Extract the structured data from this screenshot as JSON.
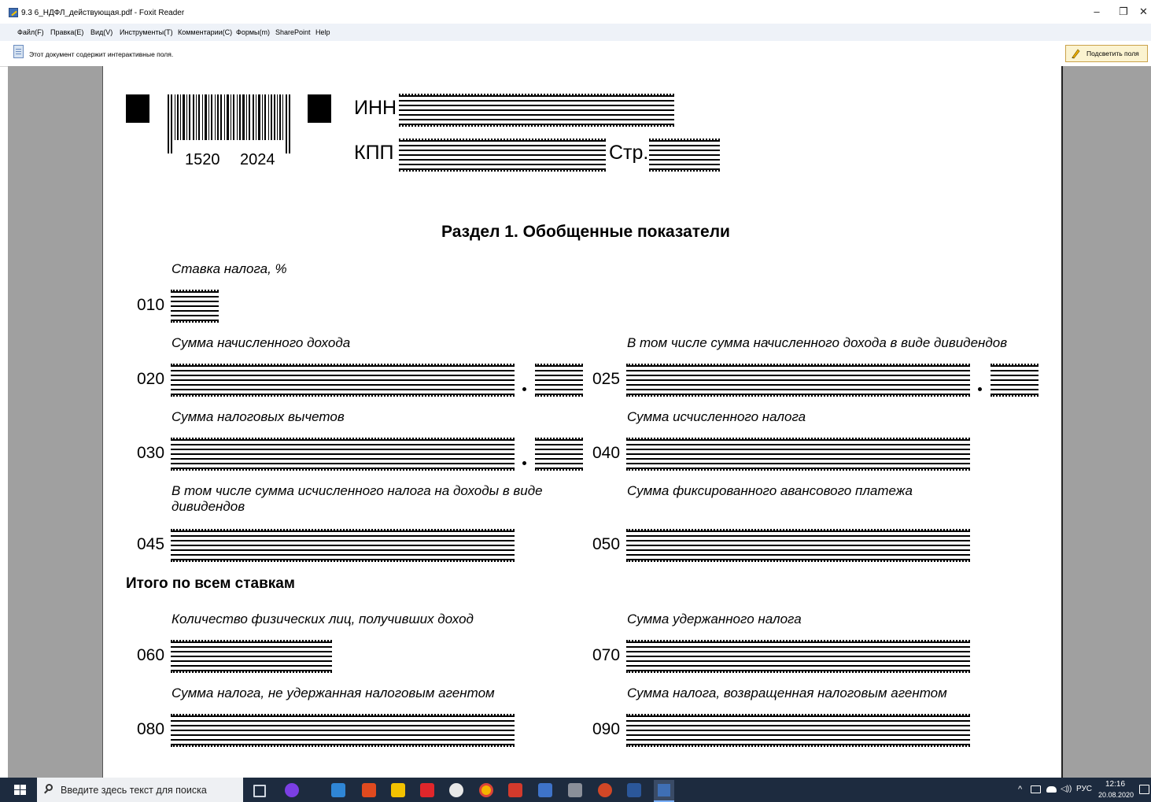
{
  "window": {
    "title": "9.3 6_НДФЛ_действующая.pdf - Foxit Reader",
    "minimize_label": "–",
    "restore_label": "❐",
    "close_label": "✕"
  },
  "menu": [
    "Файл(F)",
    "Правка(E)",
    "Вид(V)",
    "Инструменты(T)",
    "Комментарии(C)",
    "Формы(m)",
    "SharePoint",
    "Help"
  ],
  "notification": {
    "text": "Этот документ содержит интерактивные поля.",
    "highlight_button": "Подсветить поля"
  },
  "form": {
    "barcode_left": "1520",
    "barcode_right": "2024",
    "inn_label": "ИНН",
    "kpp_label": "КПП",
    "page_label": "Стр.",
    "section_title": "Раздел 1. Обобщенные показатели",
    "f010_label": "Ставка налога, %",
    "f020_label": "Сумма начисленного дохода",
    "f025_label": "В том числе сумма начисленного дохода в виде дивидендов",
    "f030_label": "Сумма налоговых вычетов",
    "f040_label": "Сумма исчисленного налога",
    "f045_label": "В том числе сумма исчисленного налога на доходы в виде дивидендов",
    "f050_label": "Сумма фиксированного авансового платежа",
    "totals_title": "Итого по всем ставкам",
    "f060_label": "Количество физических лиц, получивших доход",
    "f070_label": "Сумма удержанного налога",
    "f080_label": "Сумма налога, не удержанная налоговым агентом",
    "f090_label": "Сумма налога, возвращенная налоговым агентом",
    "codes": {
      "c010": "010",
      "c020": "020",
      "c025": "025",
      "c030": "030",
      "c040": "040",
      "c045": "045",
      "c050": "050",
      "c060": "060",
      "c070": "070",
      "c080": "080",
      "c090": "090"
    }
  },
  "taskbar": {
    "search_placeholder": "Введите здесь текст для поиска",
    "tray_arrow": "^",
    "volume": "◁))",
    "language": "РУС",
    "time": "12:16",
    "date": "20.08.2020"
  },
  "colors": {
    "taskbar": "#1d2b3f",
    "menubar": "#eef2f8",
    "viewer_bg": "#a0a0a0",
    "highlight_button": "#fbf3d0"
  }
}
